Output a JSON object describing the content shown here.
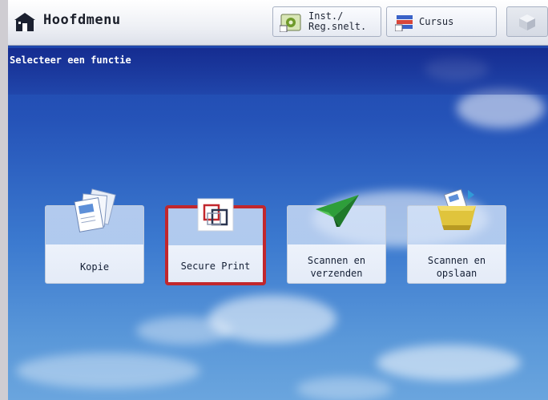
{
  "header": {
    "title": "Hoofdmenu",
    "inst_label": "Inst./\nReg.snelt.",
    "cursus_label": "Cursus"
  },
  "prompt": "Selecteer een functie",
  "functions": [
    {
      "label": "Kopie",
      "icon": "copy-icon"
    },
    {
      "label": "Secure Print",
      "icon": "secure-print-icon",
      "selected": true
    },
    {
      "label": "Scannen en\nverzenden",
      "icon": "scan-send-icon"
    },
    {
      "label": "Scannen en\nopslaan",
      "icon": "scan-store-icon"
    }
  ],
  "colors": {
    "selection": "#c1272d",
    "background": "#2553b8"
  }
}
